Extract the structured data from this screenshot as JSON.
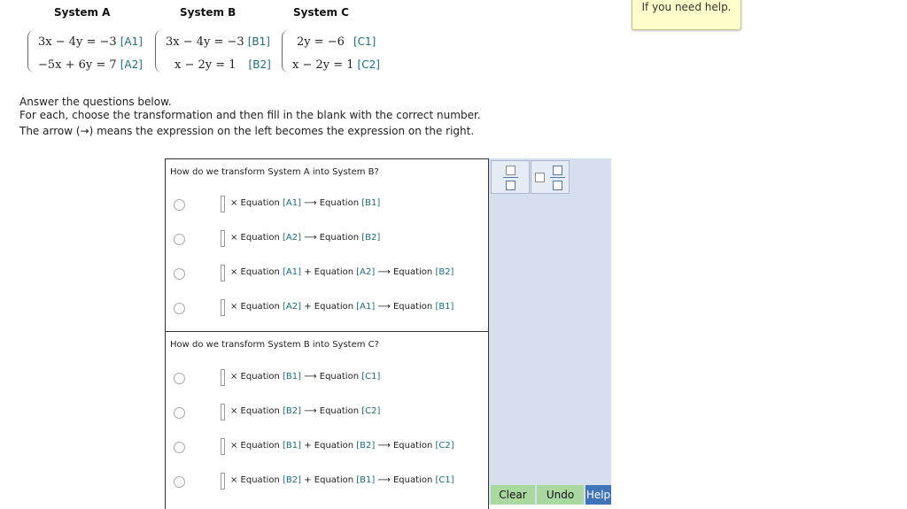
{
  "help_tip": "If you need help.",
  "systems": [
    {
      "title": "System A",
      "eqs": [
        {
          "math": "3x − 4y = −3",
          "tag": "[A1]"
        },
        {
          "math": "−5x + 6y = 7",
          "tag": "[A2]"
        }
      ]
    },
    {
      "title": "System B",
      "eqs": [
        {
          "math": "3x − 4y = −3",
          "tag": "[B1]"
        },
        {
          "math": "x − 2y = 1",
          "tag": "[B2]"
        }
      ]
    },
    {
      "title": "System C",
      "eqs": [
        {
          "math": "2y = −6",
          "tag": "[C1]"
        },
        {
          "math": "x − 2y = 1",
          "tag": "[C2]"
        }
      ]
    }
  ],
  "instructions": [
    "Answer the questions below.",
    "For each, choose the transformation and then fill in the blank with the correct number.",
    "The arrow (→) means the expression on the left becomes the expression on the right."
  ],
  "panels": [
    {
      "question": "How do we transform System A into System B?",
      "options": [
        {
          "pre": "× Equation ",
          "r1": "[A1]",
          "mid": "",
          "r2": "",
          "arrow": " ⟶ Equation ",
          "r3": "[B1]"
        },
        {
          "pre": "× Equation ",
          "r1": "[A2]",
          "mid": "",
          "r2": "",
          "arrow": " ⟶ Equation ",
          "r3": "[B2]"
        },
        {
          "pre": "× Equation ",
          "r1": "[A1]",
          "mid": " + Equation ",
          "r2": "[A2]",
          "arrow": " ⟶ Equation ",
          "r3": "[B2]"
        },
        {
          "pre": "× Equation ",
          "r1": "[A2]",
          "mid": " + Equation ",
          "r2": "[A1]",
          "arrow": " ⟶ Equation ",
          "r3": "[B1]"
        }
      ]
    },
    {
      "question": "How do we transform System B into System C?",
      "options": [
        {
          "pre": "× Equation ",
          "r1": "[B1]",
          "mid": "",
          "r2": "",
          "arrow": " ⟶ Equation ",
          "r3": "[C1]"
        },
        {
          "pre": "× Equation ",
          "r1": "[B2]",
          "mid": "",
          "r2": "",
          "arrow": " ⟶ Equation ",
          "r3": "[C2]"
        },
        {
          "pre": "× Equation ",
          "r1": "[B1]",
          "mid": " + Equation ",
          "r2": "[B2]",
          "arrow": " ⟶ Equation ",
          "r3": "[C2]"
        },
        {
          "pre": "× Equation ",
          "r1": "[B2]",
          "mid": " + Equation ",
          "r2": "[B1]",
          "arrow": " ⟶ Equation ",
          "r3": "[C1]"
        }
      ]
    }
  ],
  "toolbar": {
    "clear": "Clear",
    "undo": "Undo",
    "help": "Help"
  },
  "colors": {
    "ref": "#1a6c80",
    "side_panel": "#d6dfee",
    "clear_bg": "#a9d8a1",
    "help_bg": "#3f74b9"
  }
}
